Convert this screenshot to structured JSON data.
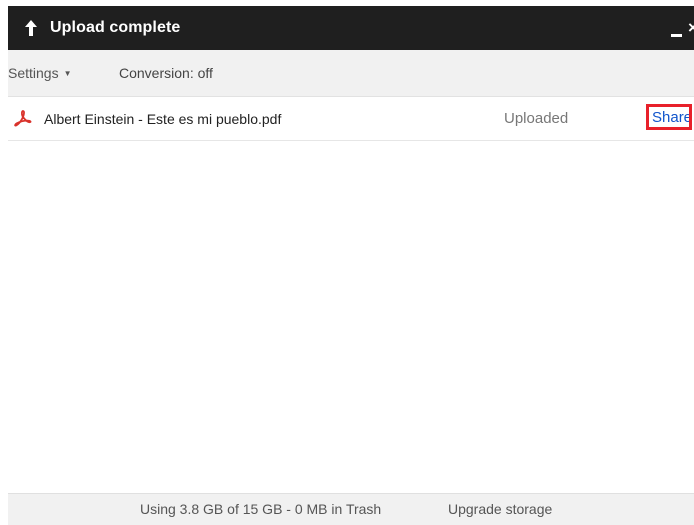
{
  "window": {
    "title": "Upload complete",
    "close_glyph": "×"
  },
  "toolbar": {
    "settings_label": "Settings",
    "caret_glyph": "▼",
    "conversion_label": "Conversion: off"
  },
  "files": [
    {
      "name": "Albert Einstein - Este es mi pueblo.pdf",
      "status": "Uploaded",
      "action": "Share",
      "icon": "pdf-icon"
    }
  ],
  "footer": {
    "usage": "Using 3.8 GB of 15 GB - 0 MB in Trash",
    "upgrade_label": "Upgrade storage"
  },
  "colors": {
    "titlebar": "#1f1f1f",
    "link": "#1155cc",
    "highlight": "#e8202a",
    "pdf_icon": "#d9322b"
  }
}
